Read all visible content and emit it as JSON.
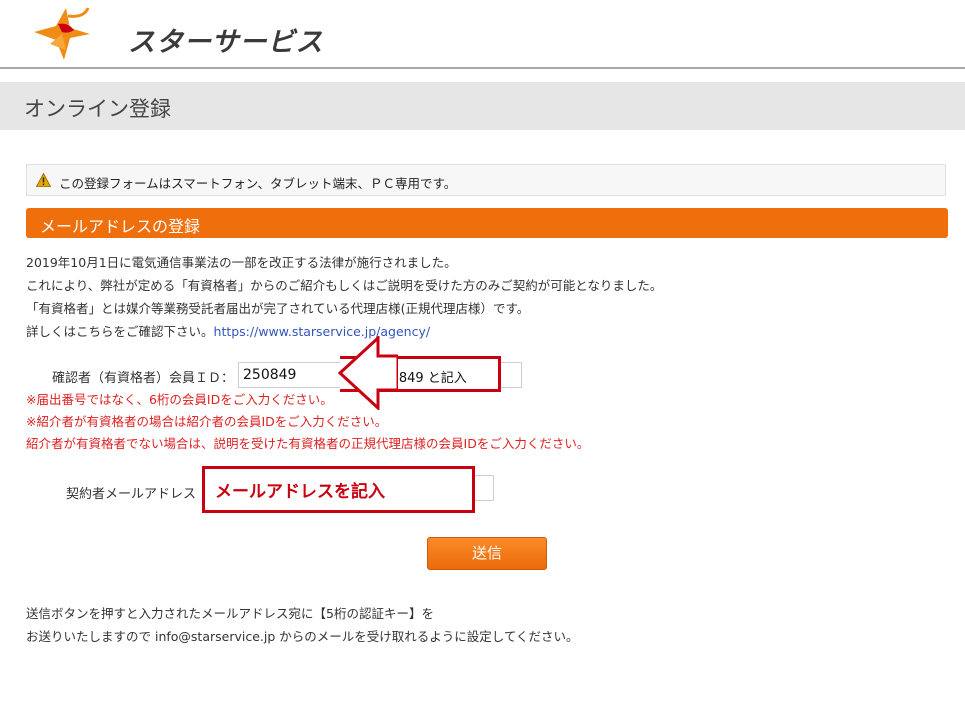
{
  "header": {
    "brand_name": "スターサービス",
    "logo_icon": "star-service-logo-icon"
  },
  "page": {
    "title": "オンライン登録"
  },
  "notice": {
    "icon": "warning-icon",
    "text": "この登録フォームはスマートフォン、タブレット端末、ＰＣ専用です。"
  },
  "section": {
    "title": "メールアドレスの登録"
  },
  "intro": {
    "line1": "2019年10月1日に電気通信事業法の一部を改正する法律が施行されました。",
    "line2": "これにより、弊社が定める「有資格者」からのご紹介もしくはご説明を受けた方のみご契約が可能となりました。",
    "line3": "「有資格者」とは媒介等業務受託者届出が完了されている代理店様(正規代理店様）です。",
    "line4_prefix": "詳しくはこちらをご確認下さい。",
    "line4_link": "https://www.starservice.jp/agency/"
  },
  "form": {
    "id_label": "確認者（有資格者）会員ＩＤ：",
    "id_value": "250849",
    "id_annotation": "250849 と記入",
    "notes": [
      "※届出番号ではなく、6桁の会員IDをご入力ください。",
      "※紹介者が有資格者の場合は紹介者の会員IDをご入力ください。",
      "紹介者が有資格者でない場合は、説明を受けた有資格者の正規代理店様の会員IDをご入力ください。"
    ],
    "email_label": "契約者メールアドレス",
    "email_annotation": "メールアドレスを記入",
    "submit_label": "送信"
  },
  "footer": {
    "line1": "送信ボタンを押すと入力されたメールアドレス宛に【5桁の認証キー】を",
    "line2": "お送りいたしますので info@starservice.jp からのメールを受け取れるように設定してください。"
  },
  "colors": {
    "accent_orange": "#ee6f0b",
    "annotation_red": "#c8000f",
    "note_red": "#dd2222",
    "link_blue": "#3355bb"
  }
}
